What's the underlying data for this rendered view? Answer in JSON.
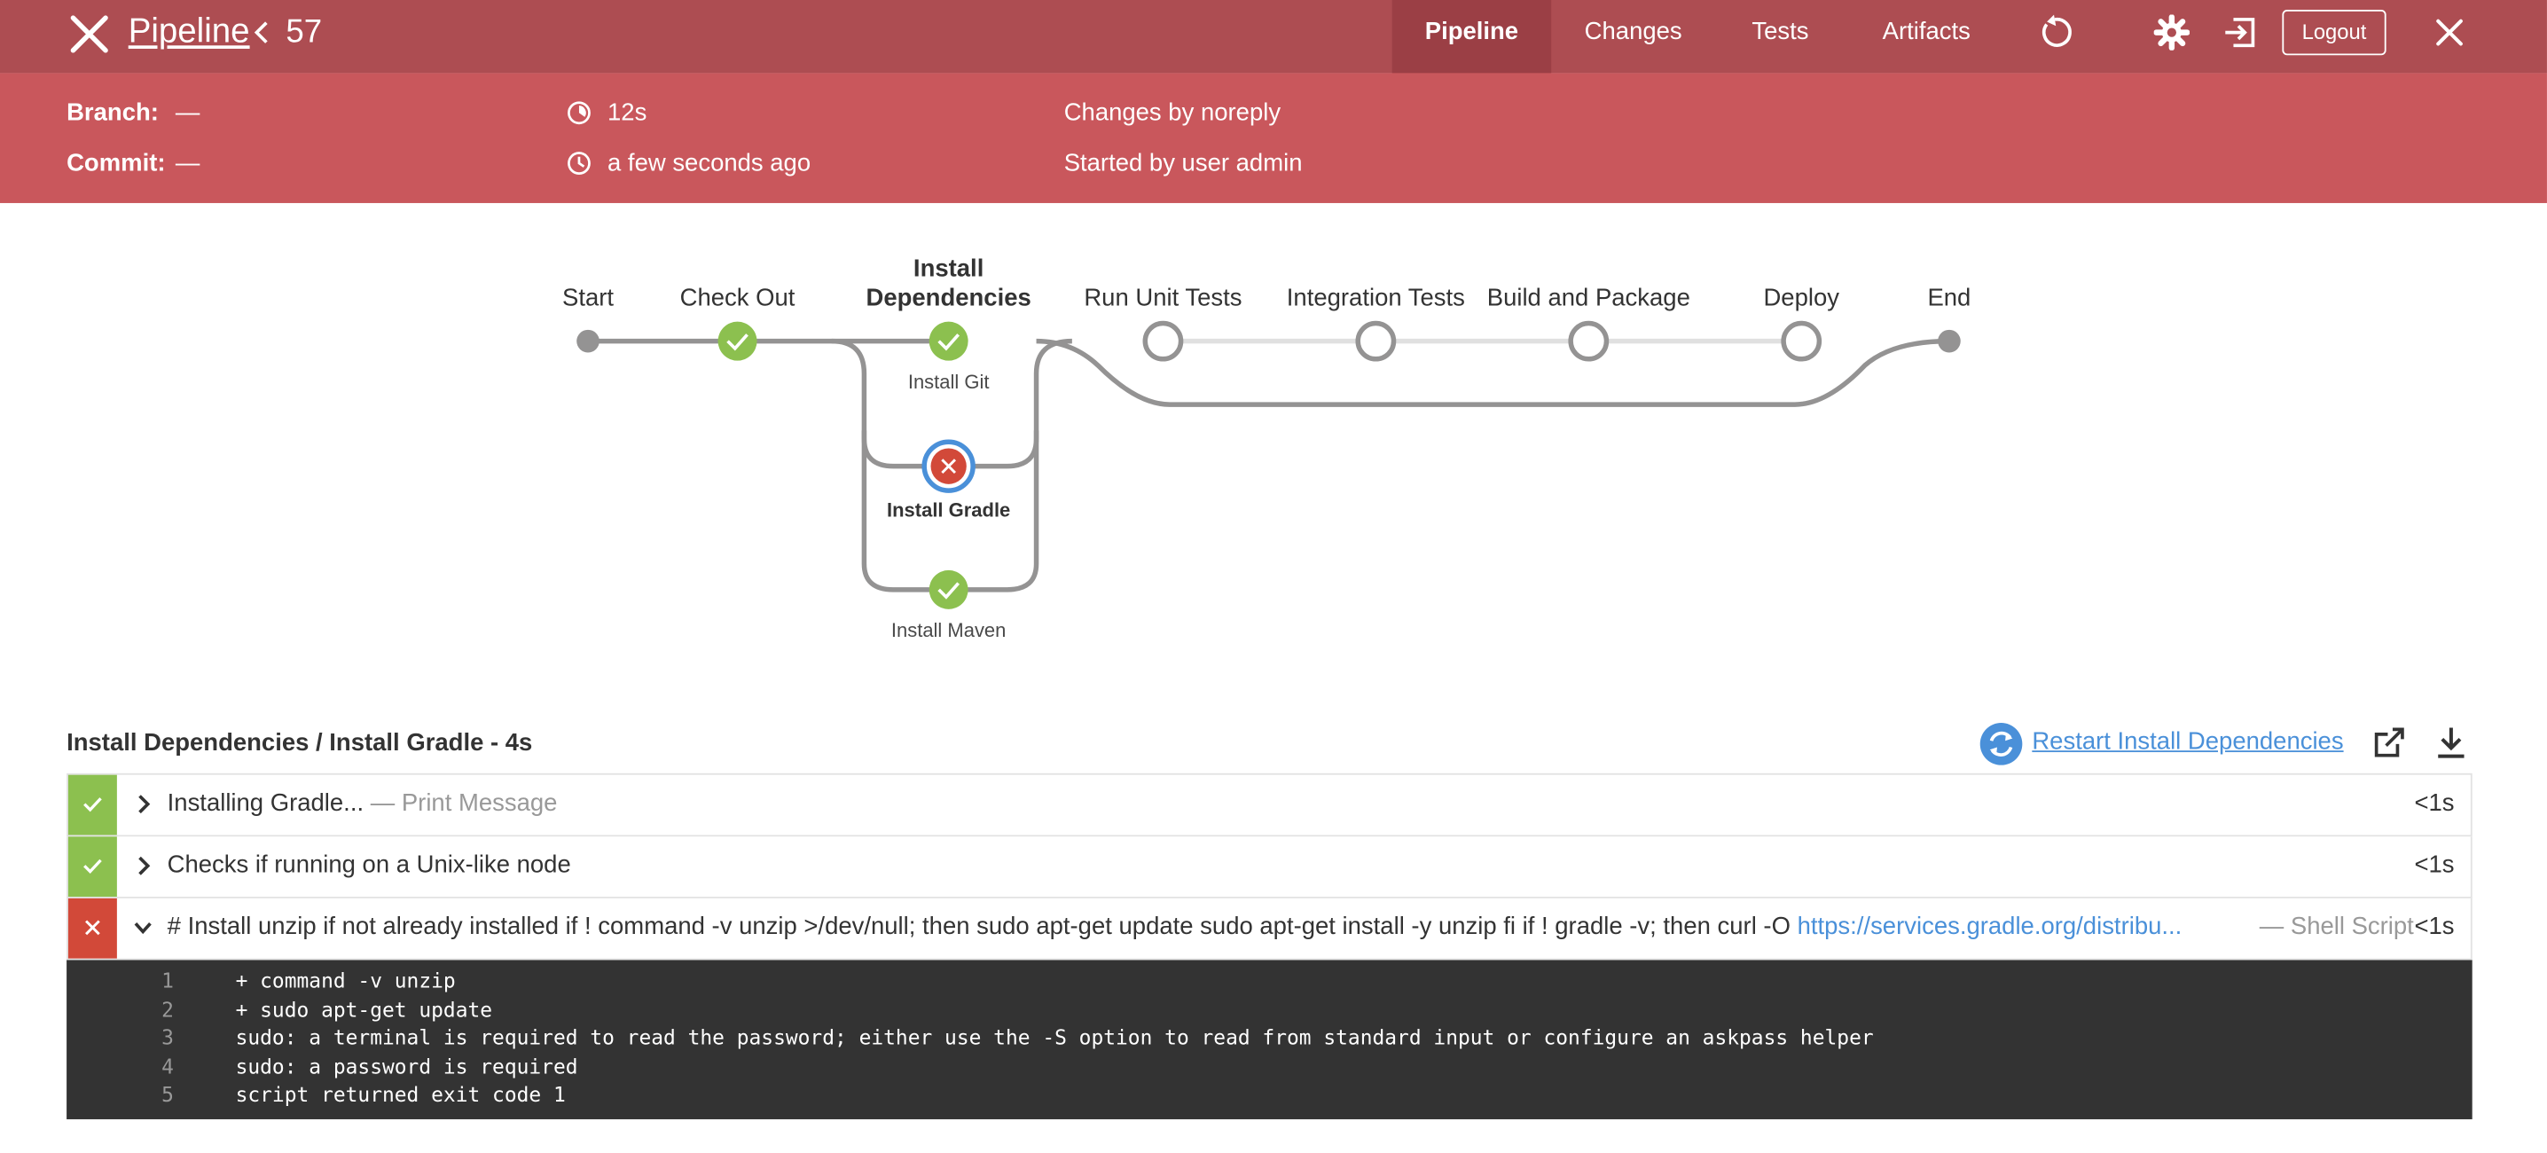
{
  "header": {
    "title": "Pipeline",
    "run_number": "57",
    "tabs": [
      {
        "label": "Pipeline",
        "active": true
      },
      {
        "label": "Changes",
        "active": false
      },
      {
        "label": "Tests",
        "active": false
      },
      {
        "label": "Artifacts",
        "active": false
      }
    ],
    "logout_label": "Logout",
    "colors": {
      "bar": "#ad4d52",
      "active_tab": "#9b3f45",
      "summary": "#c9575c"
    }
  },
  "summary": {
    "branch_label": "Branch:",
    "branch_value": "—",
    "commit_label": "Commit:",
    "commit_value": "—",
    "duration": "12s",
    "started_ago": "a few seconds ago",
    "changes_by": "Changes by noreply",
    "started_by": "Started by user admin"
  },
  "graph": {
    "stages": [
      {
        "name": "Start",
        "status": "terminal"
      },
      {
        "name": "Check Out",
        "status": "success"
      },
      {
        "name": "Install Dependencies",
        "status": "failed",
        "parallel": [
          {
            "name": "Install Git",
            "status": "success"
          },
          {
            "name": "Install Gradle",
            "status": "failed",
            "selected": true
          },
          {
            "name": "Install Maven",
            "status": "success"
          }
        ]
      },
      {
        "name": "Run Unit Tests",
        "status": "not_built"
      },
      {
        "name": "Integration Tests",
        "status": "not_built"
      },
      {
        "name": "Build and Package",
        "status": "not_built"
      },
      {
        "name": "Deploy",
        "status": "not_built"
      },
      {
        "name": "End",
        "status": "terminal"
      }
    ],
    "stage_line1": "Install",
    "stage_line2": "Dependencies",
    "colors": {
      "success": "#8cc04f",
      "failed": "#d24939",
      "selected_ring": "#4a90d9",
      "line": "#949393",
      "pending_line": "#e0e0e0"
    }
  },
  "steps_panel": {
    "breadcrumb": "Install Dependencies / Install Gradle - 4s",
    "restart_label": "Restart Install Dependencies",
    "steps": [
      {
        "status": "success",
        "title": "Installing Gradle...",
        "type": "— Print Message",
        "duration": "<1s",
        "expanded": false
      },
      {
        "status": "success",
        "title": "Checks if running on a Unix-like node",
        "type": "",
        "duration": "<1s",
        "expanded": false
      },
      {
        "status": "failed",
        "title": "# Install unzip if not already installed if ! command -v unzip >/dev/null; then sudo apt-get update sudo apt-get install -y unzip fi if ! gradle -v; then curl -O ",
        "link": "https://services.gradle.org/distribu...",
        "type": "— Shell Script",
        "duration": "<1s",
        "expanded": true
      }
    ],
    "log": [
      {
        "n": "1",
        "text": "+ command -v unzip"
      },
      {
        "n": "2",
        "text": "+ sudo apt-get update"
      },
      {
        "n": "3",
        "text": "sudo: a terminal is required to read the password; either use the -S option to read from standard input or configure an askpass helper"
      },
      {
        "n": "4",
        "text": "sudo: a password is required"
      },
      {
        "n": "5",
        "text": "script returned exit code 1"
      }
    ]
  }
}
